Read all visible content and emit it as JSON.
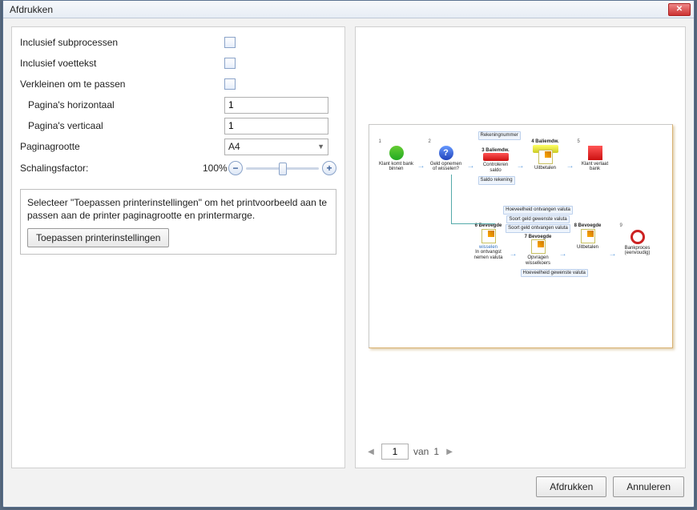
{
  "dialog": {
    "title": "Afdrukken"
  },
  "options": {
    "include_subprocesses_label": "Inclusief subprocessen",
    "include_footer_label": "Inclusief voettekst",
    "shrink_to_fit_label": "Verkleinen om te passen",
    "pages_horizontal_label": "Pagina's horizontaal",
    "pages_horizontal_value": "1",
    "pages_vertical_label": "Pagina's verticaal",
    "pages_vertical_value": "1",
    "page_size_label": "Paginagrootte",
    "page_size_value": "A4",
    "scale_label": "Schalingsfactor:",
    "scale_value": "100%"
  },
  "hint": {
    "text": "Selecteer \"Toepassen printerinstellingen\" om het printvoorbeeld aan te passen aan de printer paginagrootte en printermarge.",
    "apply_btn": "Toepassen printerinstellingen"
  },
  "preview": {
    "nodes_top": [
      {
        "num": "1",
        "label": "Klant komt bank binnen"
      },
      {
        "num": "2",
        "label": "Geld opnemen of wisselen?"
      },
      {
        "num": "3",
        "label": "3 Baliemdw.",
        "sub": "Controleren saldo",
        "tag": "Rekeningnummer"
      },
      {
        "num": "4",
        "label": "4 Baliemdw.",
        "sub": "Uitbetalen",
        "tag2": "Saldo rekening"
      },
      {
        "num": "5",
        "label": "Klant verlaat bank"
      }
    ],
    "nodes_bottom": [
      {
        "num": "6",
        "label": "6 Bevoegde",
        "sub": "In ontvangst nemen valuta",
        "left": "wisselen"
      },
      {
        "num": "7",
        "label": "7 Bevoegde",
        "sub": "Opvragen wisselkoers",
        "tags": [
          "Hoeveelheid ontvangen valuta",
          "Soort geld gewenste valuta",
          "Soort geld ontvangen valuta"
        ],
        "tag2": "Hoeveelheid gewenste valuta"
      },
      {
        "num": "8",
        "label": "8 Bevoegde",
        "sub": "Uitbetalen"
      },
      {
        "num": "9",
        "label": "Bankproces (eenvoudig)"
      }
    ]
  },
  "pager": {
    "page": "1",
    "of_label": "van",
    "total": "1"
  },
  "footer": {
    "print": "Afdrukken",
    "cancel": "Annuleren"
  }
}
